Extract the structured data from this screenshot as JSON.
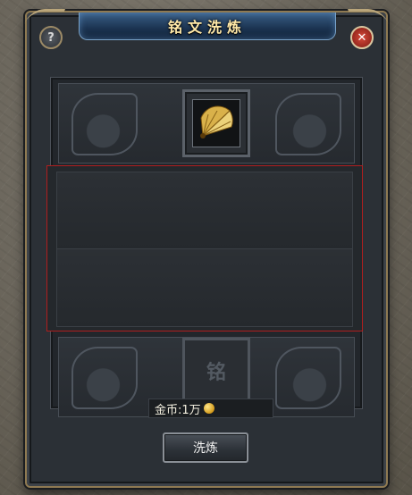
{
  "window": {
    "title": "铭文洗炼",
    "help_label": "?",
    "close_label": "✕"
  },
  "item_slot": {
    "icon": "fan-item-icon"
  },
  "rune_slot": {
    "glyph": "铭"
  },
  "cost": {
    "label": "金币:1万",
    "currency_icon": "gold-coin-icon"
  },
  "refine_button": {
    "label": "洗炼"
  },
  "colors": {
    "title_text": "#ffe9a8",
    "selection_border": "#b01e1e",
    "frame_gold": "#8f7a52"
  }
}
